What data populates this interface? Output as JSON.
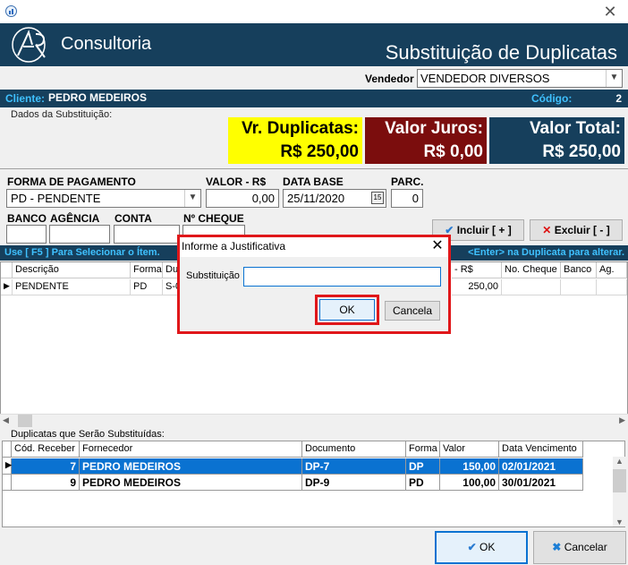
{
  "header": {
    "brand": "Consultoria",
    "title": "Substituição de Duplicatas"
  },
  "vendor": {
    "label": "Vendedor",
    "value": "VENDEDOR DIVERSOS"
  },
  "client": {
    "label": "Cliente:",
    "name": "PEDRO MEDEIROS",
    "code_label": "Código:",
    "code": "2"
  },
  "section_label": "Dados da Substituição:",
  "totals": {
    "duplicatas_label": "Vr. Duplicatas:",
    "duplicatas_value": "R$ 250,00",
    "juros_label": "Valor Juros:",
    "juros_value": "R$ 0,00",
    "total_label": "Valor Total:",
    "total_value": "R$ 250,00"
  },
  "form": {
    "forma_label": "FORMA DE PAGAMENTO",
    "forma_value": "PD - PENDENTE",
    "valor_label": "VALOR - R$",
    "valor_value": "0,00",
    "data_label": "DATA BASE",
    "data_value": "25/11/2020",
    "parc_label": "PARC.",
    "parc_value": "0",
    "banco_label": "BANCO",
    "agencia_label": "AGÊNCIA",
    "conta_label": "CONTA",
    "cheque_label": "Nº CHEQUE",
    "incluir": "Incluir [ + ]",
    "excluir": "Excluir [ - ]"
  },
  "info": {
    "left": "Use [ F5 ] Para Selecionar o Ítem.",
    "right": "<Enter> na Duplicata para alterar."
  },
  "grid1": {
    "headers": [
      "Descrição",
      "Forma",
      "Du",
      "- R$",
      "No. Cheque",
      "Banco",
      "Ag."
    ],
    "row": [
      "PENDENTE",
      "PD",
      "S-0",
      "250,00"
    ]
  },
  "grid2": {
    "title": "Duplicatas que Serão Substituídas:",
    "headers": [
      "Cód. Receber",
      "Fornecedor",
      "Documento",
      "Forma",
      "Valor",
      "Data Vencimento"
    ],
    "rows": [
      [
        "7",
        "PEDRO MEDEIROS",
        "DP-7",
        "DP",
        "150,00",
        "02/01/2021"
      ],
      [
        "9",
        "PEDRO MEDEIROS",
        "DP-9",
        "PD",
        "100,00",
        "30/01/2021"
      ]
    ]
  },
  "buttons": {
    "ok": "OK",
    "cancel": "Cancelar"
  },
  "modal": {
    "title": "Informe a Justificativa",
    "field_label": "Substituição",
    "field_value": "",
    "ok": "OK",
    "cancel": "Cancela"
  },
  "colors": {
    "navy": "#163f5c",
    "yellow": "#ffff00",
    "maroon": "#7b0d0d",
    "cyan_label": "#3fc1ff",
    "selection": "#0a72d1",
    "highlight": "#e0171a"
  }
}
